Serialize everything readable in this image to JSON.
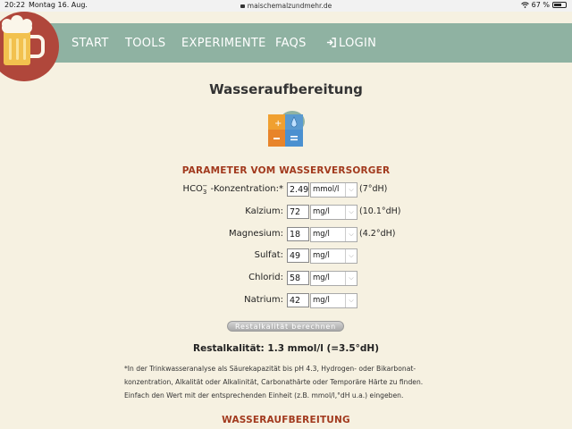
{
  "status_bar": {
    "time": "20:22",
    "date": "Montag 16. Aug.",
    "url": "maischemalzundmehr.de",
    "battery": "67 %",
    "battery_level": 0.67
  },
  "nav": {
    "items": [
      "START",
      "TOOLS",
      "EXPERIMENTE",
      "FAQS"
    ],
    "login": "LOGIN"
  },
  "page_title": "Wasseraufbereitung",
  "section_params": "PARAMETER VOM WASSERVERSORGER",
  "params": [
    {
      "label": "HCO₃⁻-Konzentration:*",
      "value": "2.49",
      "unit": "mmol/l",
      "dh": "(7°dH)"
    },
    {
      "label": "Kalzium:",
      "value": "72",
      "unit": "mg/l",
      "dh": "(10.1°dH)"
    },
    {
      "label": "Magnesium:",
      "value": "18",
      "unit": "mg/l",
      "dh": "(4.2°dH)"
    },
    {
      "label": "Sulfat:",
      "value": "49",
      "unit": "mg/l",
      "dh": ""
    },
    {
      "label": "Chlorid:",
      "value": "58",
      "unit": "mg/l",
      "dh": ""
    },
    {
      "label": "Natrium:",
      "value": "42",
      "unit": "mg/l",
      "dh": ""
    }
  ],
  "calc_button": "Restalkalität berechnen",
  "result": "Restalkalität: 1.3 mmol/l (=3.5°dH)",
  "note": {
    "line1": "*In der Trinkwasseranalyse als Säurekapazität bis pH 4.3, Hydrogen- oder Bikarbonat-",
    "line2": "konzentration, Alkalität oder Alkalinität, Carbonathärte oder Temporäre Härte zu finden.",
    "line3": "Einfach den Wert mit der entsprechenden Einheit (z.B. mmol/l,°dH u.a.) eingeben."
  },
  "section_treatment": "WASSERAUFBEREITUNG",
  "colors": {
    "background": "#f6f1e1",
    "nav": "#8fb2a2",
    "section_heading": "#a23a1e",
    "logo_circle": "#b0473b"
  }
}
